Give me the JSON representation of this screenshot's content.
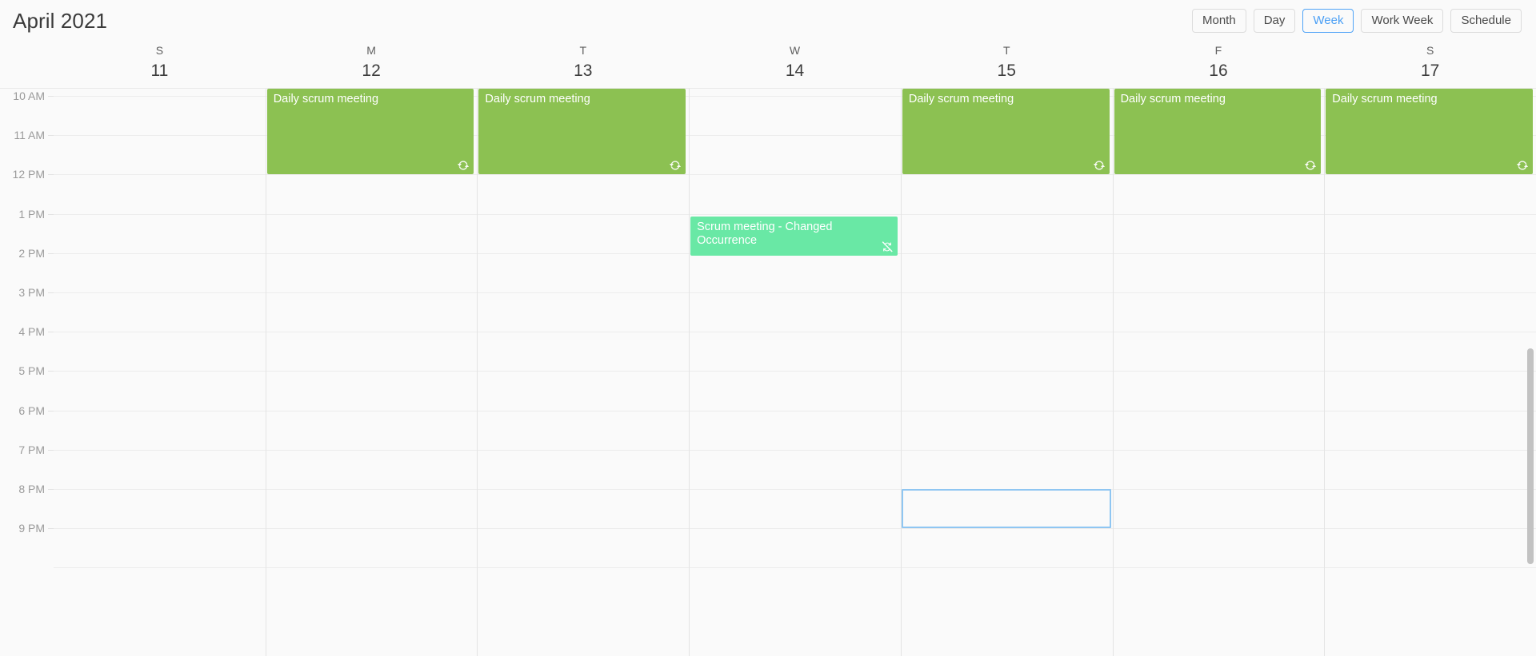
{
  "toolbar": {
    "title": "April 2021",
    "views": [
      {
        "label": "Month",
        "active": false
      },
      {
        "label": "Day",
        "active": false
      },
      {
        "label": "Week",
        "active": true
      },
      {
        "label": "Work Week",
        "active": false
      },
      {
        "label": "Schedule",
        "active": false
      }
    ]
  },
  "days": [
    {
      "name": "S",
      "number": "11"
    },
    {
      "name": "M",
      "number": "12"
    },
    {
      "name": "T",
      "number": "13"
    },
    {
      "name": "W",
      "number": "14"
    },
    {
      "name": "T",
      "number": "15"
    },
    {
      "name": "F",
      "number": "16"
    },
    {
      "name": "S",
      "number": "17"
    }
  ],
  "time_labels": [
    "10 AM",
    "11 AM",
    "12 PM",
    "1 PM",
    "2 PM",
    "3 PM",
    "4 PM",
    "5 PM",
    "6 PM",
    "7 PM",
    "8 PM",
    "9 PM"
  ],
  "events": [
    {
      "title": "Daily scrum meeting",
      "day": 1,
      "icon": "recurrence-icon",
      "color": "#8CC152"
    },
    {
      "title": "Daily scrum meeting",
      "day": 2,
      "icon": "recurrence-icon",
      "color": "#8CC152"
    },
    {
      "title": "Scrum meeting - Changed Occurrence",
      "day": 3,
      "icon": "recurrence-exception-icon",
      "color": "#69E8A5"
    },
    {
      "title": "Daily scrum meeting",
      "day": 4,
      "icon": "recurrence-icon",
      "color": "#8CC152"
    },
    {
      "title": "Daily scrum meeting",
      "day": 5,
      "icon": "recurrence-icon",
      "color": "#8CC152"
    },
    {
      "title": "Daily scrum meeting",
      "day": 6,
      "icon": "recurrence-icon",
      "color": "#8CC152"
    }
  ],
  "selection": {
    "day": 4,
    "label": ""
  },
  "colors": {
    "accent": "#4a9ff5",
    "event_green": "#8CC152",
    "event_teal": "#69E8A5",
    "selection_border": "#8fc6f2",
    "grid_line": "#ececec",
    "background": "#fafafa"
  },
  "scrollbar": {
    "position": "right",
    "orientation": "vertical"
  }
}
